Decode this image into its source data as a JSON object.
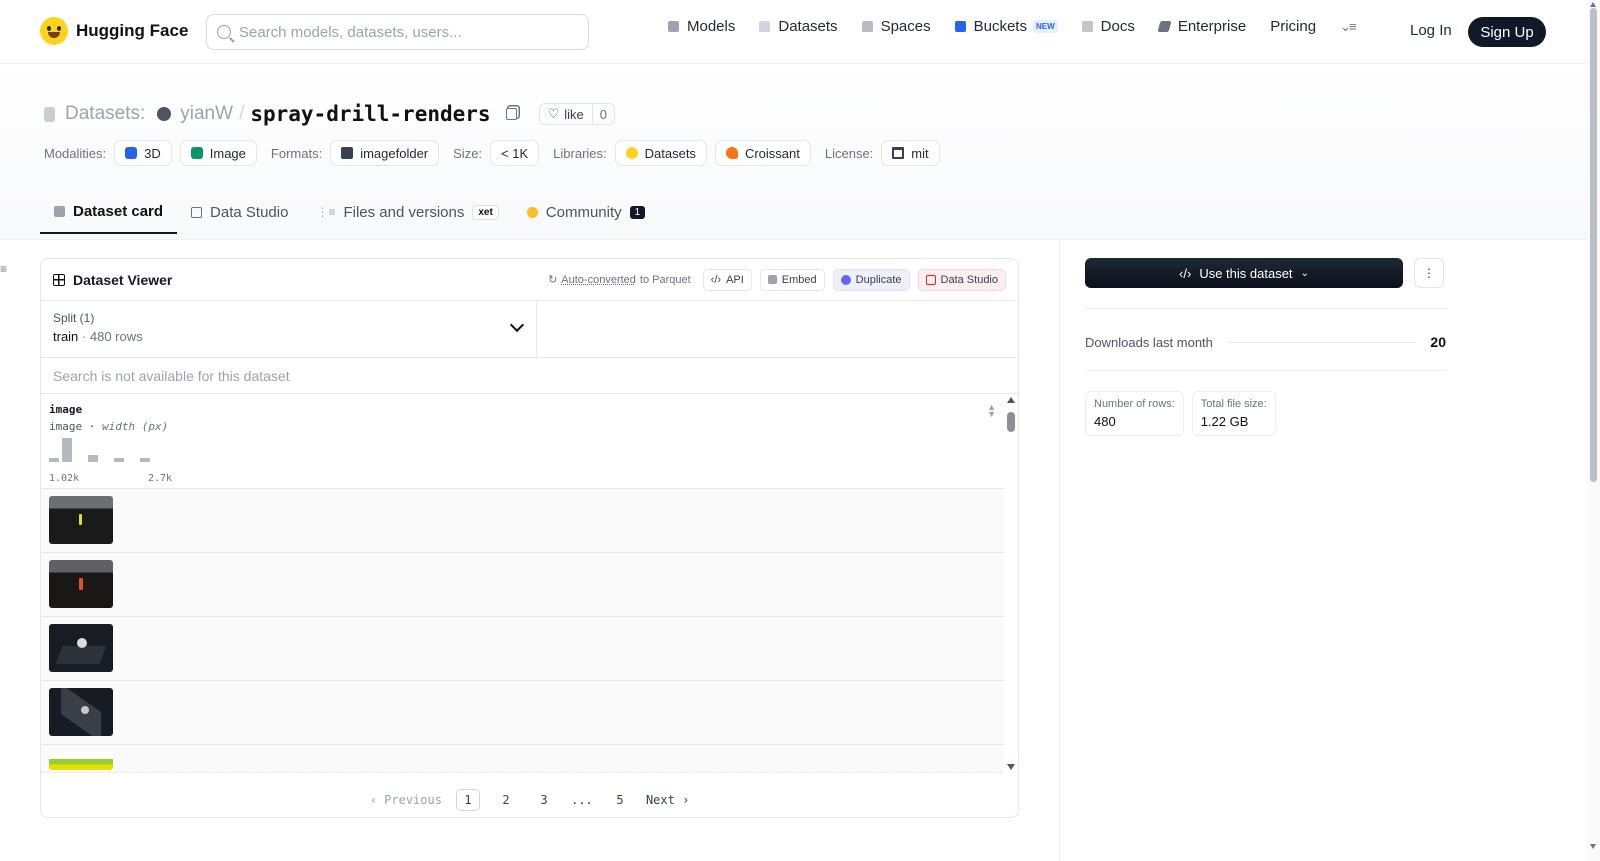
{
  "nav": {
    "brand": "Hugging Face",
    "search_placeholder": "Search models, datasets, users...",
    "links": [
      {
        "label": "Models",
        "icon": "models-icon",
        "color": "#9ca3af"
      },
      {
        "label": "Datasets",
        "icon": "datasets-icon",
        "color": "#d1d5db"
      },
      {
        "label": "Spaces",
        "icon": "spaces-icon",
        "color": "#9ca3af"
      },
      {
        "label": "Buckets",
        "icon": "buckets-icon",
        "color": "#2563eb",
        "badge": "NEW"
      },
      {
        "label": "Docs",
        "icon": "docs-icon",
        "color": "#9ca3af"
      },
      {
        "label": "Enterprise",
        "icon": "enterprise-icon",
        "color": "#6b7280"
      },
      {
        "label": "Pricing"
      }
    ],
    "login": "Log In",
    "signup": "Sign Up"
  },
  "header": {
    "section": "Datasets:",
    "owner": "yianW",
    "separator": "/",
    "repo": "spray-drill-renders",
    "like_label": "like",
    "like_count": "0",
    "modalities_label": "Modalities:",
    "modalities": [
      {
        "label": "3D",
        "color": "#2563eb"
      },
      {
        "label": "Image",
        "color": "#059669"
      }
    ],
    "formats_label": "Formats:",
    "format": "imagefolder",
    "size_label": "Size:",
    "size": "< 1K",
    "libraries_label": "Libraries:",
    "libraries": [
      {
        "label": "Datasets",
        "color": "#ffd21e"
      },
      {
        "label": "Croissant",
        "color": "#f97316"
      }
    ],
    "license_label": "License:",
    "license": "mit"
  },
  "tabs": [
    {
      "label": "Dataset card",
      "active": true
    },
    {
      "label": "Data Studio"
    },
    {
      "label": "Files and versions",
      "badge": "xet"
    },
    {
      "label": "Community",
      "count": "1"
    }
  ],
  "viewer": {
    "title": "Dataset Viewer",
    "auto_converted": "Auto-converted",
    "auto_suffix": " to Parquet",
    "actions": [
      "API",
      "Embed",
      "Duplicate",
      "Data Studio"
    ],
    "split_label": "Split (1)",
    "split_value": "train",
    "split_rows": "480 rows",
    "search_na": "Search is not available for this dataset",
    "column": {
      "name": "image",
      "type": "image",
      "subtype": "width (px)",
      "min_label": "1.02k",
      "max_label": "2.7k",
      "histogram": [
        0.15,
        1.0,
        0.0,
        0.3,
        0.0,
        0.15,
        0.0,
        0.15
      ]
    },
    "pagination": {
      "previous": "Previous",
      "pages": [
        "1",
        "2",
        "3",
        "...",
        "5"
      ],
      "current": "1",
      "next": "Next"
    }
  },
  "sidebar": {
    "use_button": "Use this dataset",
    "downloads_label": "Downloads last month",
    "downloads_value": "20",
    "stats": [
      {
        "label": "Number of rows:",
        "value": "480"
      },
      {
        "label": "Total file size:",
        "value": "1.22 GB"
      }
    ]
  }
}
